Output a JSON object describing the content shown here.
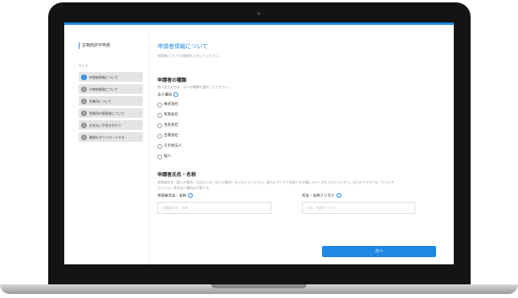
{
  "sidebar": {
    "title": "古物商許可申請",
    "section_label": "もくじ",
    "items": [
      {
        "num": "1",
        "label": "申請者情報について"
      },
      {
        "num": "2",
        "label": "古物商業務について"
      },
      {
        "num": "3",
        "label": "営業所について"
      },
      {
        "num": "4",
        "label": "営業所の管理者について"
      },
      {
        "num": "5",
        "label": "お支払い手続きを行う"
      },
      {
        "num": "6",
        "label": "書類をダウンロードする"
      }
    ]
  },
  "main": {
    "title": "申請者情報について",
    "description": "申請者についての情報を入力してください。",
    "applicant_type": {
      "heading": "申請者の種類",
      "hint": "個人使えの方は、法人の種類を選択してください。",
      "field_label": "法人種別",
      "options": [
        "株式会社",
        "有限会社",
        "合名会社",
        "合資会社",
        "その他法人",
        "個人"
      ]
    },
    "applicant_name": {
      "heading": "申請者氏名・名称",
      "hint_line1": "申請者氏名（個人の場合）又は法人名（法人の場合）を入力してください。個人のフリガナは姓と名の間にスペースを入れてください。法人のフリガナは「カブシキ",
      "hint_line2": "ガイシャ」等の法人種別は不要です。",
      "name_label": "申請者氏名・名称",
      "name_placeholder": "申請者氏名・名称",
      "kana_label": "氏名・名称フリガナ",
      "kana_placeholder": "氏名・名称フリガナ"
    },
    "next_button": "次へ"
  },
  "colors": {
    "accent": "#1e88e5"
  },
  "icons": {
    "info": "info-icon",
    "chevron": "chevron-right-icon"
  }
}
